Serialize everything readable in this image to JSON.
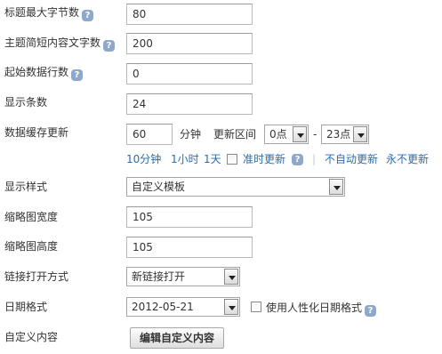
{
  "rows": {
    "title_max_bytes": {
      "label": "标题最大字节数",
      "value": "80"
    },
    "summary_length": {
      "label": "主题简短内容文字数",
      "value": "200"
    },
    "start_row": {
      "label": "起始数据行数",
      "value": "0"
    },
    "display_count": {
      "label": "显示条数",
      "value": "24"
    },
    "cache": {
      "label": "数据缓存更新",
      "value": "60",
      "unit": "分钟",
      "range_label": "更新区间",
      "from": "0点",
      "dash": "-",
      "to": "23点",
      "quick": [
        "10分钟",
        "1小时",
        "1天"
      ],
      "on_time_label": "准时更新",
      "separator": "|",
      "no_auto": "不自动更新",
      "never": "永不更新"
    },
    "display_style": {
      "label": "显示样式",
      "value": "自定义模板"
    },
    "thumb_width": {
      "label": "缩略图宽度",
      "value": "105"
    },
    "thumb_height": {
      "label": "缩略图高度",
      "value": "105"
    },
    "link_open": {
      "label": "链接打开方式",
      "value": "新链接打开"
    },
    "date_format": {
      "label": "日期格式",
      "value": "2012-05-21",
      "humanize_label": "使用人性化日期格式"
    },
    "custom_content": {
      "label": "自定义内容",
      "button": "编辑自定义内容"
    }
  },
  "help_icon_glyph": "?",
  "colors": {
    "link": "#2a6db0",
    "help_icon": "#8fa7c9"
  }
}
